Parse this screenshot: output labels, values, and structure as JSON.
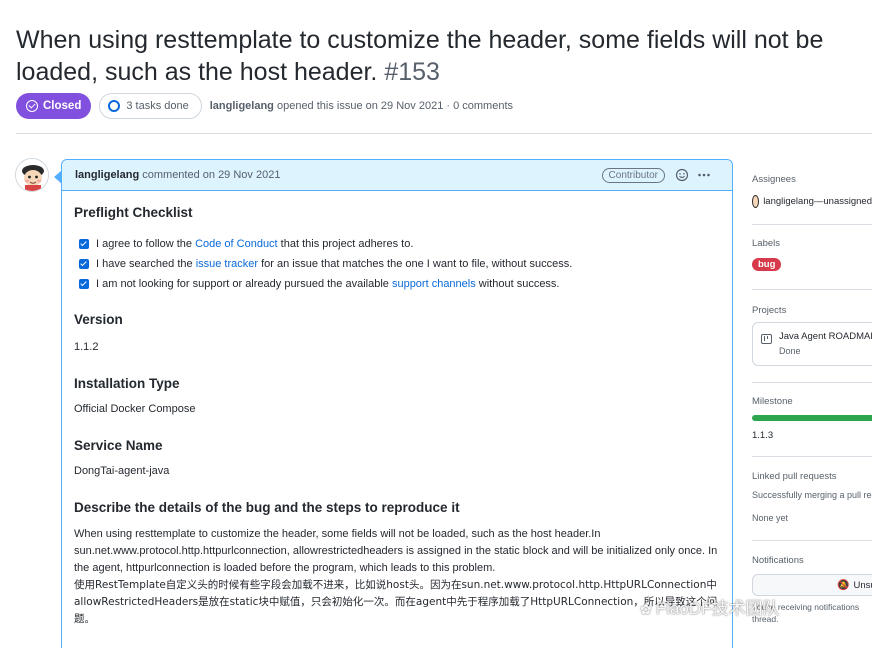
{
  "issue": {
    "title": "When using resttemplate to customize the header, some fields will not be loaded, such as the host header.",
    "number": "#153",
    "state": "Closed",
    "tasks": "3 tasks done",
    "author": "langligelang",
    "meta_suffix": "opened this issue on 29 Nov 2021 · 0 comments"
  },
  "comment": {
    "author": "langligelang",
    "action": "commented on 29 Nov 2021",
    "role": "Contributor",
    "emoji_icon": "smiley-icon",
    "menu_icon": "kebab-icon",
    "sections": {
      "preflight_heading": "Preflight Checklist",
      "checklist": [
        {
          "before": "I agree to follow the ",
          "link": "Code of Conduct",
          "after": " that this project adheres to."
        },
        {
          "before": "I have searched the ",
          "link": "issue tracker",
          "after": " for an issue that matches the one I want to file, without success."
        },
        {
          "before": "I am not looking for support or already pursued the available ",
          "link": "support channels",
          "after": " without success."
        }
      ],
      "version_heading": "Version",
      "version_value": "1.1.2",
      "install_heading": "Installation Type",
      "install_value": "Official Docker Compose",
      "service_heading": "Service Name",
      "service_value": "DongTai-agent-java",
      "bug_heading": "Describe the details of the bug and the steps to reproduce it",
      "bug_text_en": "When using resttemplate to customize the header, some fields will not be loaded, such as the host header.In sun.net.www.protocol.http.httpurlconnection, allowrestrictedheaders is assigned in the static block and will be initialized only once. In the agent, httpurlconnection is loaded before the program, which leads to this problem.",
      "bug_text_zh": "使用RestTemplate自定义头的时候有些字段会加载不进来，比如说host头。因为在sun.net.www.protocol.http.HttpURLConnection中allowRestrictedHeaders是放在static块中赋值，只会初始化一次。而在agent中先于程序加载了HttpURLConnection，所以导致这个问题。"
    }
  },
  "sidebar": {
    "assignees_heading": "Assignees",
    "assignee": "langligelang—unassigned",
    "labels_heading": "Labels",
    "label": "bug",
    "label_color": "#d73a4a",
    "projects_heading": "Projects",
    "project_name": "Java Agent ROADMAP",
    "project_status": "Done",
    "milestone_heading": "Milestone",
    "milestone_progress": 1.0,
    "milestone_name": "1.1.3",
    "linked_heading": "Linked pull requests",
    "linked_text": "Successfully merging a pull request",
    "linked_none": "None yet",
    "notifications_heading": "Notifications",
    "notifications_button": "Unsubscribe",
    "notifications_note_1": "You're receiving notifications",
    "notifications_note_2": "thread."
  },
  "watermark": "FlaoDF技术团队",
  "colors": {
    "closed": "#8250df",
    "link": "#0969da",
    "comment_border": "#54aeff",
    "comment_header": "#ddf4ff",
    "milestone": "#2da44e"
  }
}
